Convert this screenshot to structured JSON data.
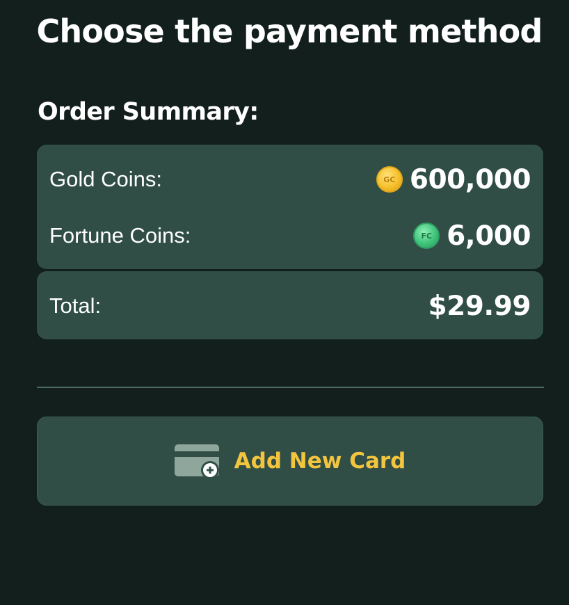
{
  "header": {
    "title": "Choose the payment method"
  },
  "order_summary": {
    "title": "Order Summary:",
    "gold_coins": {
      "label": "Gold Coins:",
      "icon": "gold-coin-icon",
      "icon_text": "GC",
      "value": "600,000"
    },
    "fortune_coins": {
      "label": "Fortune Coins:",
      "icon": "fortune-coin-icon",
      "icon_text": "FC",
      "value": "6,000"
    },
    "total": {
      "label": "Total:",
      "value": "$29.99"
    }
  },
  "add_card": {
    "label": "Add New Card",
    "icon": "credit-card-plus-icon"
  },
  "colors": {
    "background": "#121f1d",
    "card": "#304e46",
    "accent": "#f3c53e"
  }
}
